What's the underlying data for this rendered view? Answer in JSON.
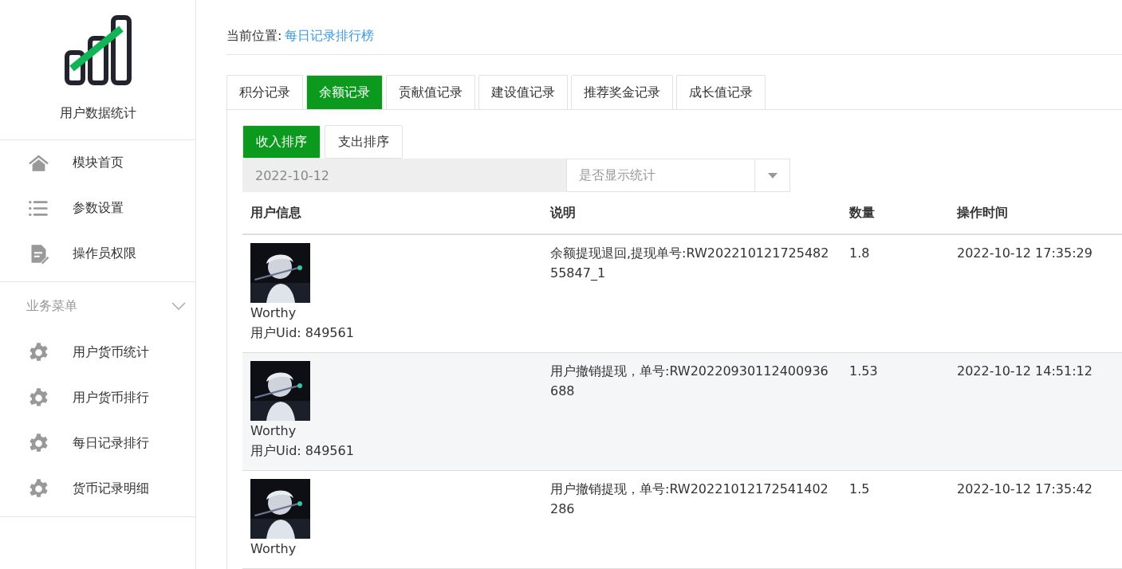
{
  "sidebar": {
    "app_title": "用户数据统计",
    "items": [
      {
        "label": "模块首页"
      },
      {
        "label": "参数设置"
      },
      {
        "label": "操作员权限"
      }
    ],
    "group": {
      "label": "业务菜单",
      "expanded": true,
      "items": [
        {
          "label": "用户货币统计"
        },
        {
          "label": "用户货币排行"
        },
        {
          "label": "每日记录排行"
        },
        {
          "label": "货币记录明细"
        }
      ]
    }
  },
  "breadcrumb": {
    "label": "当前位置:",
    "current": "每日记录排行榜"
  },
  "tabs": [
    {
      "label": "积分记录",
      "selected": false
    },
    {
      "label": "余额记录",
      "selected": true
    },
    {
      "label": "贡献值记录",
      "selected": false
    },
    {
      "label": "建设值记录",
      "selected": false
    },
    {
      "label": "推荐奖金记录",
      "selected": false
    },
    {
      "label": "成长值记录",
      "selected": false
    }
  ],
  "sort_buttons": [
    {
      "label": "收入排序",
      "selected": true
    },
    {
      "label": "支出排序",
      "selected": false
    }
  ],
  "filters": {
    "date": "2022-10-12",
    "stats_select": {
      "placeholder": "是否显示统计"
    }
  },
  "table": {
    "columns": [
      "用户信息",
      "说明",
      "数量",
      "操作时间"
    ],
    "rows": [
      {
        "name": "Worthy",
        "uid": "用户Uid: 849561",
        "description": "余额提现退回,提现单号:RW20221012172548255847_1",
        "amount": "1.8",
        "time": "2022-10-12 17:35:29"
      },
      {
        "name": "Worthy",
        "uid": "用户Uid: 849561",
        "description": "用户撤销提现，单号:RW20220930112400936688",
        "amount": "1.53",
        "time": "2022-10-12 14:51:12"
      },
      {
        "name": "Worthy",
        "description": "用户撤销提现，单号:RW20221012172541402286",
        "amount": "1.5",
        "time": "2022-10-12 17:35:42"
      }
    ]
  }
}
